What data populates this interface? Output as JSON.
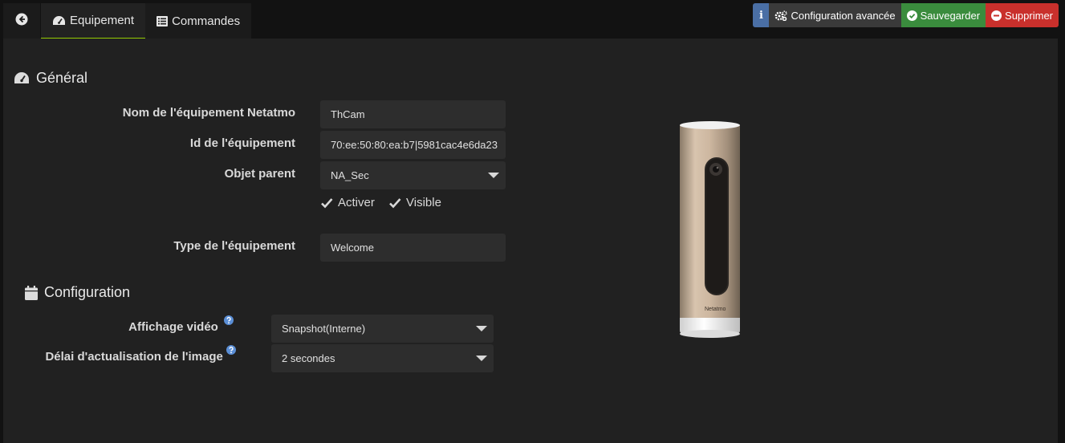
{
  "tabs": {
    "back_icon": "arrow-circle-left-icon",
    "equipment": {
      "label": "Equipement",
      "icon": "tachometer-icon"
    },
    "commands": {
      "label": "Commandes",
      "icon": "list-icon"
    }
  },
  "actions": {
    "info_label": "i",
    "advanced": "Configuration avancée",
    "save": "Sauvegarder",
    "delete": "Supprimer"
  },
  "general": {
    "title": "Général",
    "name_label": "Nom de l'équipement Netatmo",
    "name_value": "ThCam",
    "id_label": "Id de l'équipement",
    "id_value": "70:ee:50:80:ea:b7|5981cac4e6da23",
    "parent_label": "Objet parent",
    "parent_value": "NA_Sec",
    "activate_label": "Activer",
    "visible_label": "Visible",
    "type_label": "Type de l'équipement",
    "type_value": "Welcome"
  },
  "configuration": {
    "title": "Configuration",
    "video_label": "Affichage vidéo",
    "video_value": "Snapshot(Interne)",
    "delay_label": "Délai d'actualisation de l'image",
    "delay_value": "2 secondes"
  },
  "device_image": {
    "brand_text": "Netatmo"
  },
  "colors": {
    "accent": "#94ca02",
    "info": "#4a6fa5",
    "save": "#3a8c3d",
    "delete": "#c9302c",
    "help": "#5b8fd6"
  }
}
